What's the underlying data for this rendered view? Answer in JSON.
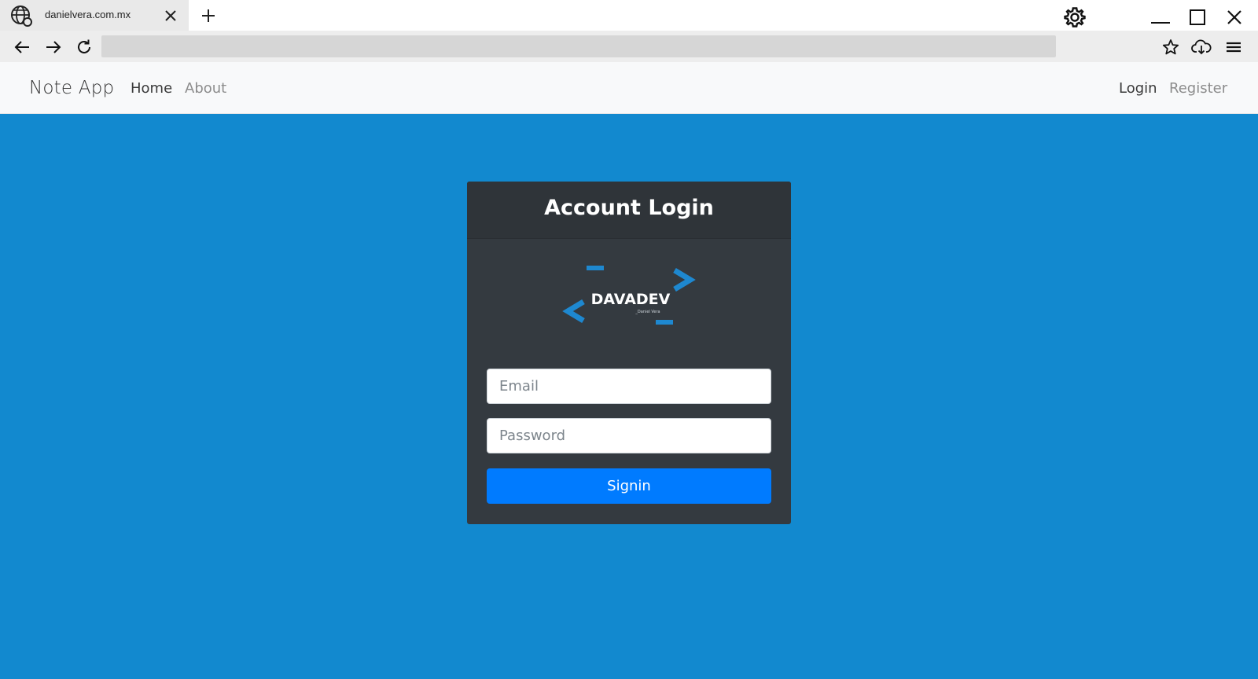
{
  "browser": {
    "tab_title": "danielvera.com.mx",
    "address_value": "",
    "icons": {
      "site": "globe-icon",
      "close_tab": "close-icon",
      "new_tab": "plus-icon",
      "settings": "gear-icon",
      "minimize": "minimize-icon",
      "maximize": "maximize-icon",
      "close_window": "close-icon",
      "back": "arrow-left-icon",
      "forward": "arrow-right-icon",
      "reload": "reload-icon",
      "bookmark": "star-icon",
      "download": "cloud-download-icon",
      "menu": "hamburger-menu-icon"
    }
  },
  "navbar": {
    "brand": "Note App",
    "links": [
      {
        "label": "Home",
        "state": "active"
      },
      {
        "label": "About",
        "state": "muted"
      }
    ],
    "right_links": [
      {
        "label": "Login",
        "state": "active"
      },
      {
        "label": "Register",
        "state": "muted"
      }
    ]
  },
  "login": {
    "title": "Account Login",
    "logo": {
      "text": "DAVADEV",
      "subtext": "_Daniel Vera"
    },
    "email_placeholder": "Email",
    "email_value": "",
    "password_placeholder": "Password",
    "password_value": "",
    "submit_label": "Signin"
  },
  "colors": {
    "page_background": "#1289cf",
    "card_background": "#343a40",
    "navbar_background": "#f8f9fa",
    "button_primary": "#007bff",
    "logo_accent": "#1e88d0"
  }
}
